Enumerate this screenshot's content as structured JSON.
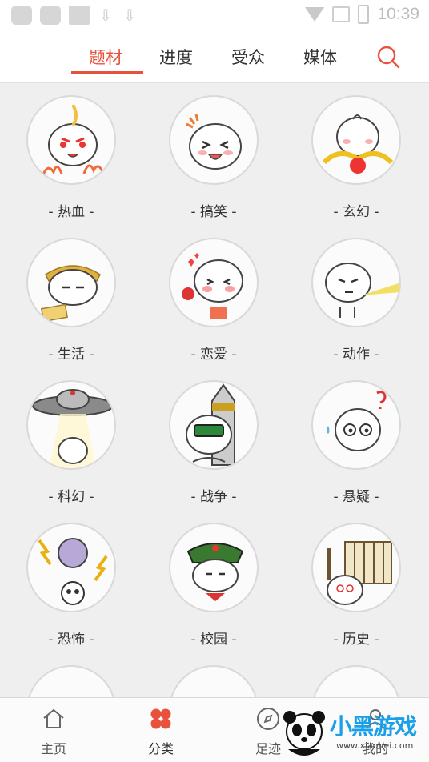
{
  "status_bar": {
    "time": "10:39"
  },
  "tabs": [
    {
      "label": "题材",
      "active": true
    },
    {
      "label": "进度",
      "active": false
    },
    {
      "label": "受众",
      "active": false
    },
    {
      "label": "媒体",
      "active": false
    }
  ],
  "categories": [
    {
      "label": "- 热血 -",
      "icon": "hot-blood-mascot"
    },
    {
      "label": "- 搞笑 -",
      "icon": "funny-mascot"
    },
    {
      "label": "- 玄幻 -",
      "icon": "fantasy-mascot"
    },
    {
      "label": "- 生活 -",
      "icon": "life-mascot"
    },
    {
      "label": "- 恋爱 -",
      "icon": "romance-mascot"
    },
    {
      "label": "- 动作 -",
      "icon": "action-mascot"
    },
    {
      "label": "- 科幻 -",
      "icon": "scifi-mascot"
    },
    {
      "label": "- 战争 -",
      "icon": "war-mascot"
    },
    {
      "label": "- 悬疑 -",
      "icon": "mystery-mascot"
    },
    {
      "label": "- 恐怖 -",
      "icon": "horror-mascot"
    },
    {
      "label": "- 校园 -",
      "icon": "campus-mascot"
    },
    {
      "label": "- 历史 -",
      "icon": "history-mascot"
    }
  ],
  "bottom_nav": [
    {
      "label": "主页",
      "icon": "home-icon"
    },
    {
      "label": "分类",
      "icon": "category-icon",
      "active": true
    },
    {
      "label": "足迹",
      "icon": "compass-icon"
    },
    {
      "label": "我的",
      "icon": "user-icon"
    }
  ],
  "watermark": {
    "text": "小黑游戏",
    "url": "www.xiaohei.com"
  },
  "colors": {
    "accent": "#e8523c",
    "background": "#efefef"
  }
}
